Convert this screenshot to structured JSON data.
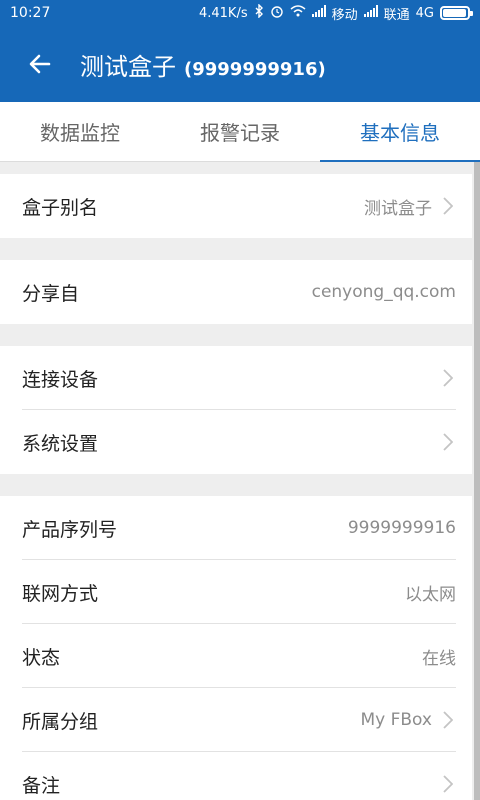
{
  "status": {
    "time": "10:27",
    "speed": "4.41K/s",
    "carrier1": "移动",
    "carrier2": "联通",
    "network": "4G",
    "battery_level": 0.95
  },
  "header": {
    "title": "测试盒子",
    "subtitle": "(9999999916)"
  },
  "tabs": [
    {
      "label": "数据监控"
    },
    {
      "label": "报警记录"
    },
    {
      "label": "基本信息"
    }
  ],
  "rows": {
    "alias": {
      "label": "盒子别名",
      "value": "测试盒子"
    },
    "shared": {
      "label": "分享自",
      "value": "cenyong_qq.com"
    },
    "connect": {
      "label": "连接设备"
    },
    "system": {
      "label": "系统设置"
    },
    "serial": {
      "label": "产品序列号",
      "value": "9999999916"
    },
    "network": {
      "label": "联网方式",
      "value": "以太网"
    },
    "state": {
      "label": "状态",
      "value": "在线"
    },
    "group": {
      "label": "所属分组",
      "value": "My FBox"
    },
    "note": {
      "label": "备注"
    }
  },
  "colors": {
    "primary": "#1668b8",
    "tab_active": "#1f6fbe",
    "background": "#eeeeee"
  }
}
